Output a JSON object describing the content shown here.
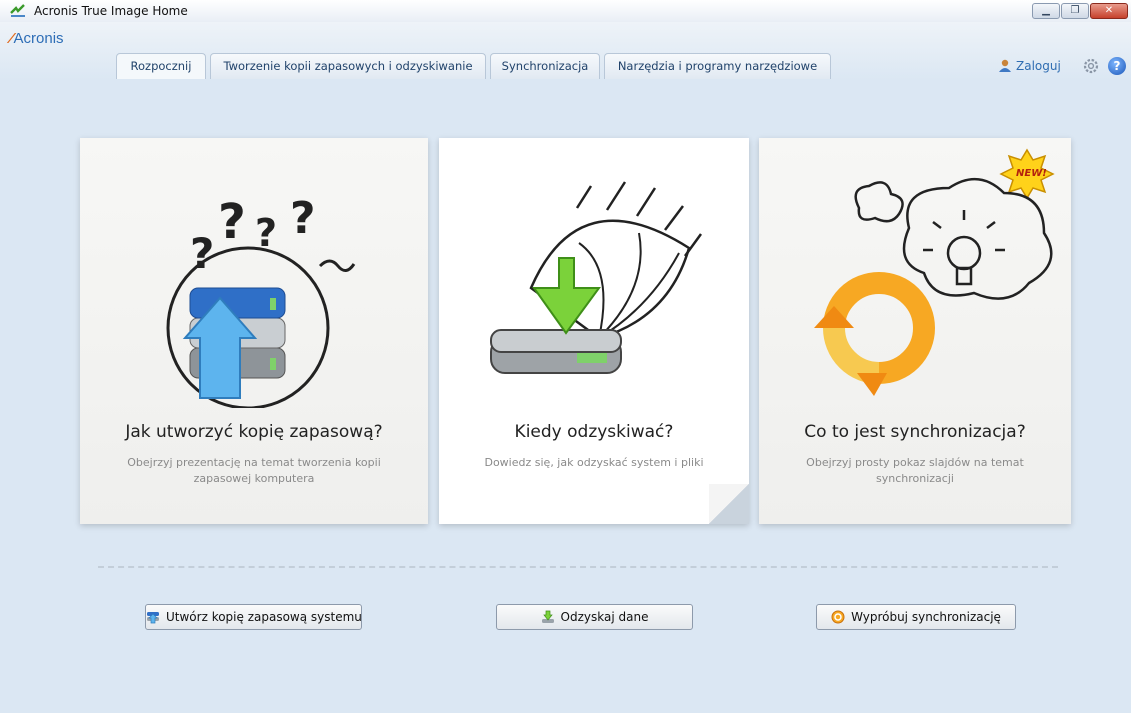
{
  "window": {
    "title": "Acronis True Image Home"
  },
  "header": {
    "logo_text": "Acronis",
    "tabs": [
      {
        "label": "Rozpocznij",
        "active": true
      },
      {
        "label": "Tworzenie kopii zapasowych i odzyskiwanie",
        "active": false
      },
      {
        "label": "Synchronizacja",
        "active": false
      },
      {
        "label": "Narzędzia i programy narzędziowe",
        "active": false
      }
    ],
    "login_label": "Zaloguj",
    "help_label": "?"
  },
  "cards": [
    {
      "title": "Jak utworzyć kopię zapasową?",
      "description": "Obejrzyj prezentację na temat tworzenia kopii zapasowej komputera",
      "icon": "backup-drives-illustration"
    },
    {
      "title": "Kiedy odzyskiwać?",
      "description": "Dowiedz się, jak odzyskać system i pliki",
      "icon": "recovery-umbrella-illustration"
    },
    {
      "title": "Co to jest synchronizacja?",
      "description": "Obejrzyj prosty pokaz slajdów na temat synchronizacji",
      "badge": "NEW!",
      "icon": "sync-arrows-illustration"
    }
  ],
  "actions": [
    {
      "label": "Utwórz kopię zapasową systemu",
      "icon": "backup-icon"
    },
    {
      "label": "Odzyskaj dane",
      "icon": "recover-icon"
    },
    {
      "label": "Wypróbuj synchronizację",
      "icon": "sync-icon"
    }
  ],
  "colors": {
    "background": "#dbe7f3",
    "accent": "#2d6db6",
    "logo_orange": "#e06a1e",
    "badge_yellow": "#ffd21a"
  }
}
